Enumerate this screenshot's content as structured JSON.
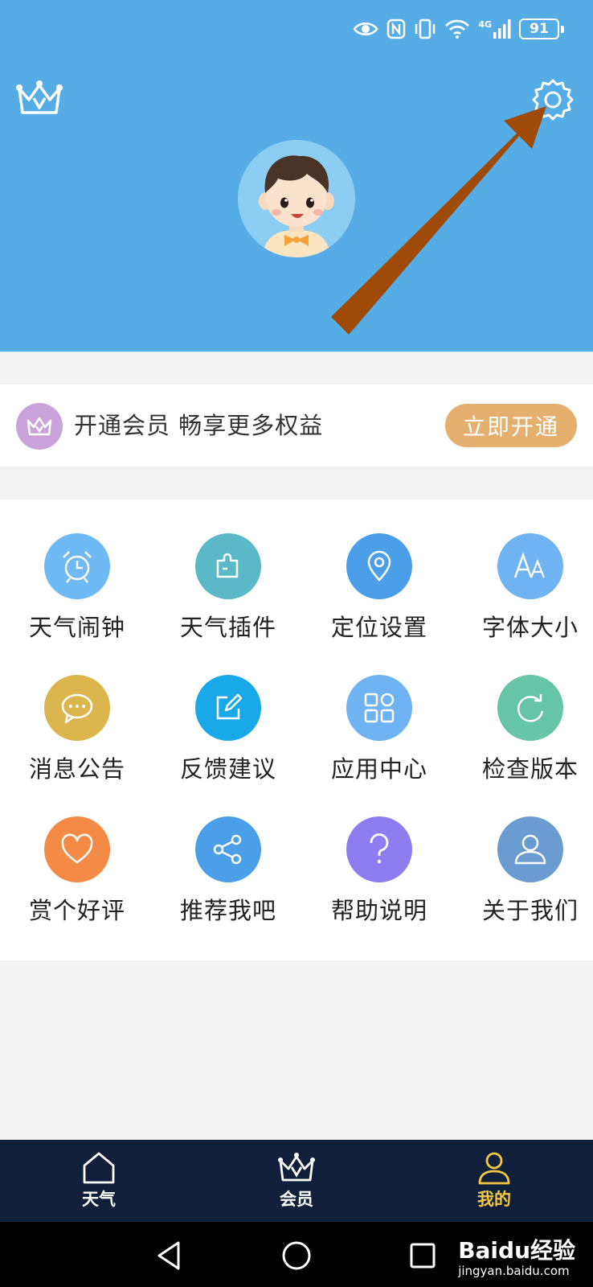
{
  "status_bar": {
    "battery": "91",
    "network": "4G"
  },
  "header": {
    "crown_icon": "crown-icon",
    "settings_icon": "gear-icon",
    "avatar": "boy-avatar",
    "bg_color": "#56ade6",
    "arrow_color": "#a04a08"
  },
  "vip": {
    "text": "开通会员 畅享更多权益",
    "button": "立即开通",
    "button_color": "#e5b06f"
  },
  "grid": [
    {
      "label": "天气闹钟",
      "icon": "alarm-clock-icon",
      "color": "#6fb9f4"
    },
    {
      "label": "天气插件",
      "icon": "puzzle-icon",
      "color": "#5bb8c7"
    },
    {
      "label": "定位设置",
      "icon": "location-pin-icon",
      "color": "#4b9ee8"
    },
    {
      "label": "字体大小",
      "icon": "font-size-icon",
      "color": "#6fb3f2"
    },
    {
      "label": "消息公告",
      "icon": "message-icon",
      "color": "#dbb54e"
    },
    {
      "label": "反馈建议",
      "icon": "edit-icon",
      "color": "#1aa9e8"
    },
    {
      "label": "应用中心",
      "icon": "apps-grid-icon",
      "color": "#6fb3f2"
    },
    {
      "label": "检查版本",
      "icon": "refresh-icon",
      "color": "#66c5a6"
    },
    {
      "label": "赏个好评",
      "icon": "heart-icon",
      "color": "#f38a45"
    },
    {
      "label": "推荐我吧",
      "icon": "share-icon",
      "color": "#4b9ee8"
    },
    {
      "label": "帮助说明",
      "icon": "question-icon",
      "color": "#8e7cf1"
    },
    {
      "label": "关于我们",
      "icon": "user-icon",
      "color": "#6a9bd1"
    }
  ],
  "tabs": [
    {
      "label": "天气",
      "icon": "home-icon"
    },
    {
      "label": "会员",
      "icon": "crown-icon"
    },
    {
      "label": "我的",
      "icon": "person-icon",
      "active": true
    }
  ],
  "watermark": {
    "main": "Baidu经验",
    "sub": "jingyan.baidu.com"
  }
}
